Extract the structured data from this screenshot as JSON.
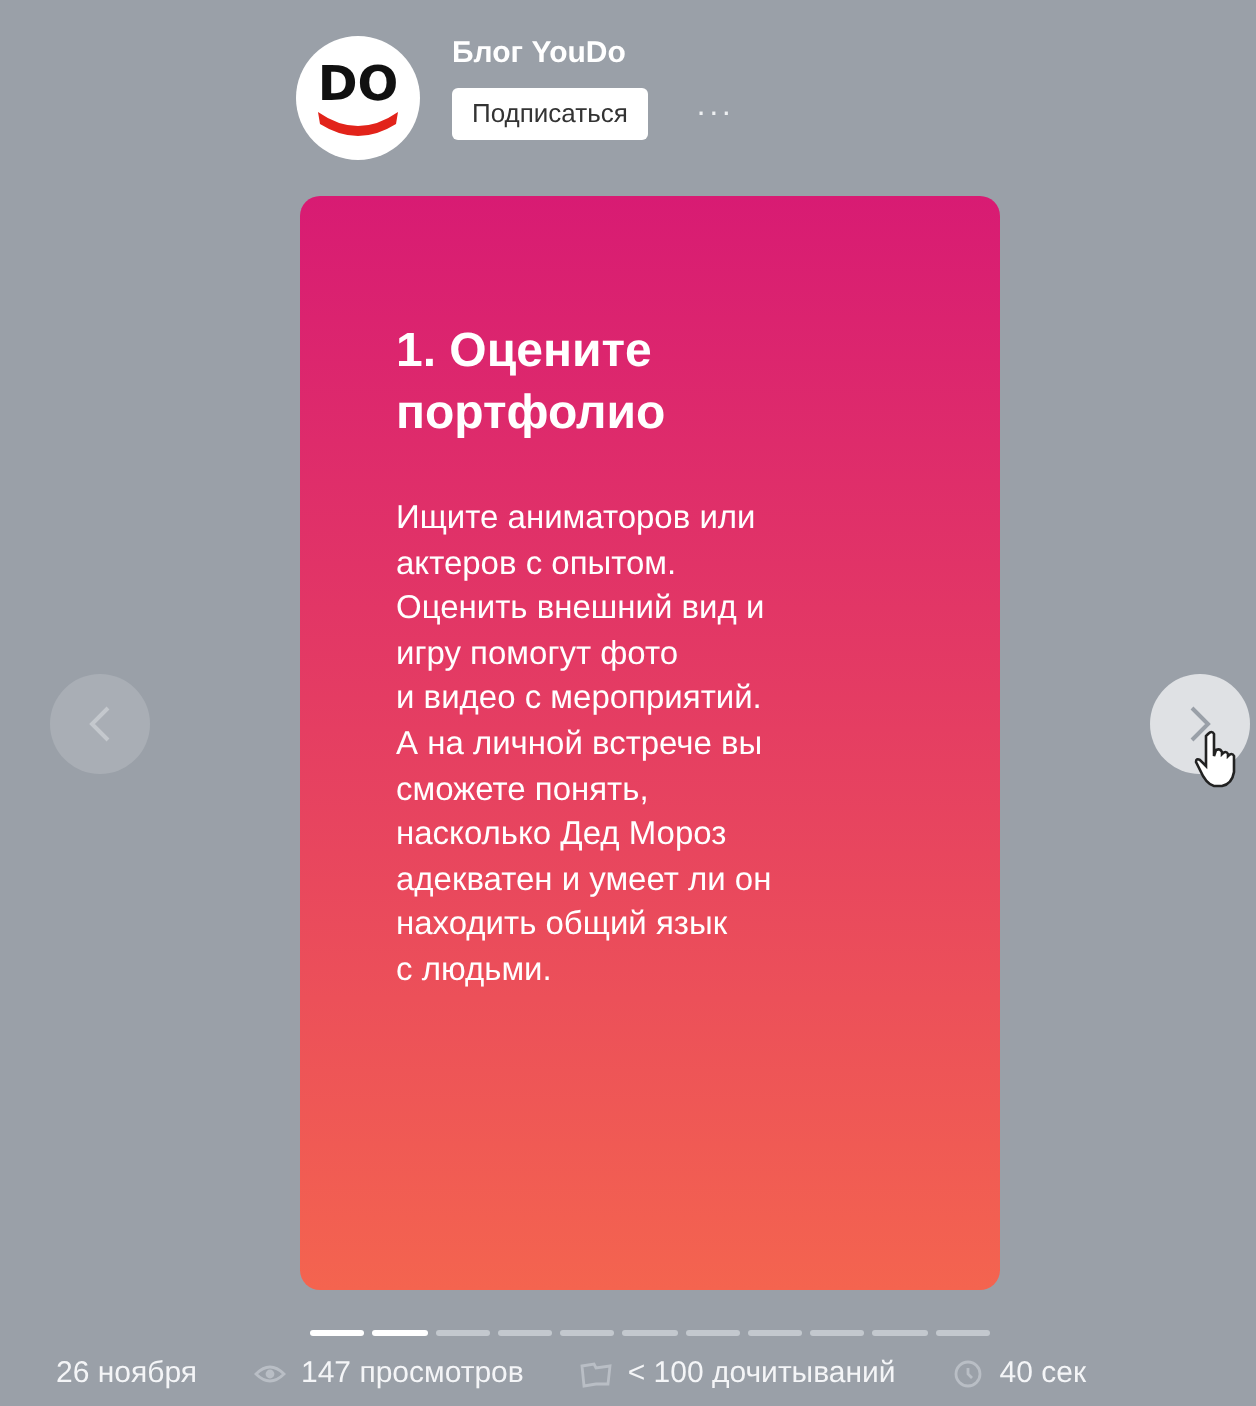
{
  "channel": {
    "logo_text": "DO",
    "name": "Блог YouDo",
    "subscribe_button": "Подписаться",
    "more": "···"
  },
  "story": {
    "title": "1. Оцените портфолио",
    "body": "Ищите аниматоров или\nактеров с опытом.\nОценить внешний вид и\nигру помогут фото\nи видео с мероприятий.\nА на личной встрече вы\nсможете понять,\nнасколько Дед Мороз\nадекватен и умеет ли он\nнаходить общий язык\nс людьми."
  },
  "progress": [
    {
      "viewed": true
    },
    {
      "viewed": true
    },
    {
      "viewed": false
    },
    {
      "viewed": false
    },
    {
      "viewed": false
    },
    {
      "viewed": false
    },
    {
      "viewed": false
    },
    {
      "viewed": false
    },
    {
      "viewed": false
    },
    {
      "viewed": false
    },
    {
      "viewed": false
    }
  ],
  "stats": [
    {
      "kind": "date",
      "text": "26 ноября"
    },
    {
      "kind": "views",
      "text": "147 просмотров"
    },
    {
      "kind": "reads",
      "text": "< 100 дочитываний"
    },
    {
      "kind": "time",
      "text": "40 сек"
    }
  ]
}
